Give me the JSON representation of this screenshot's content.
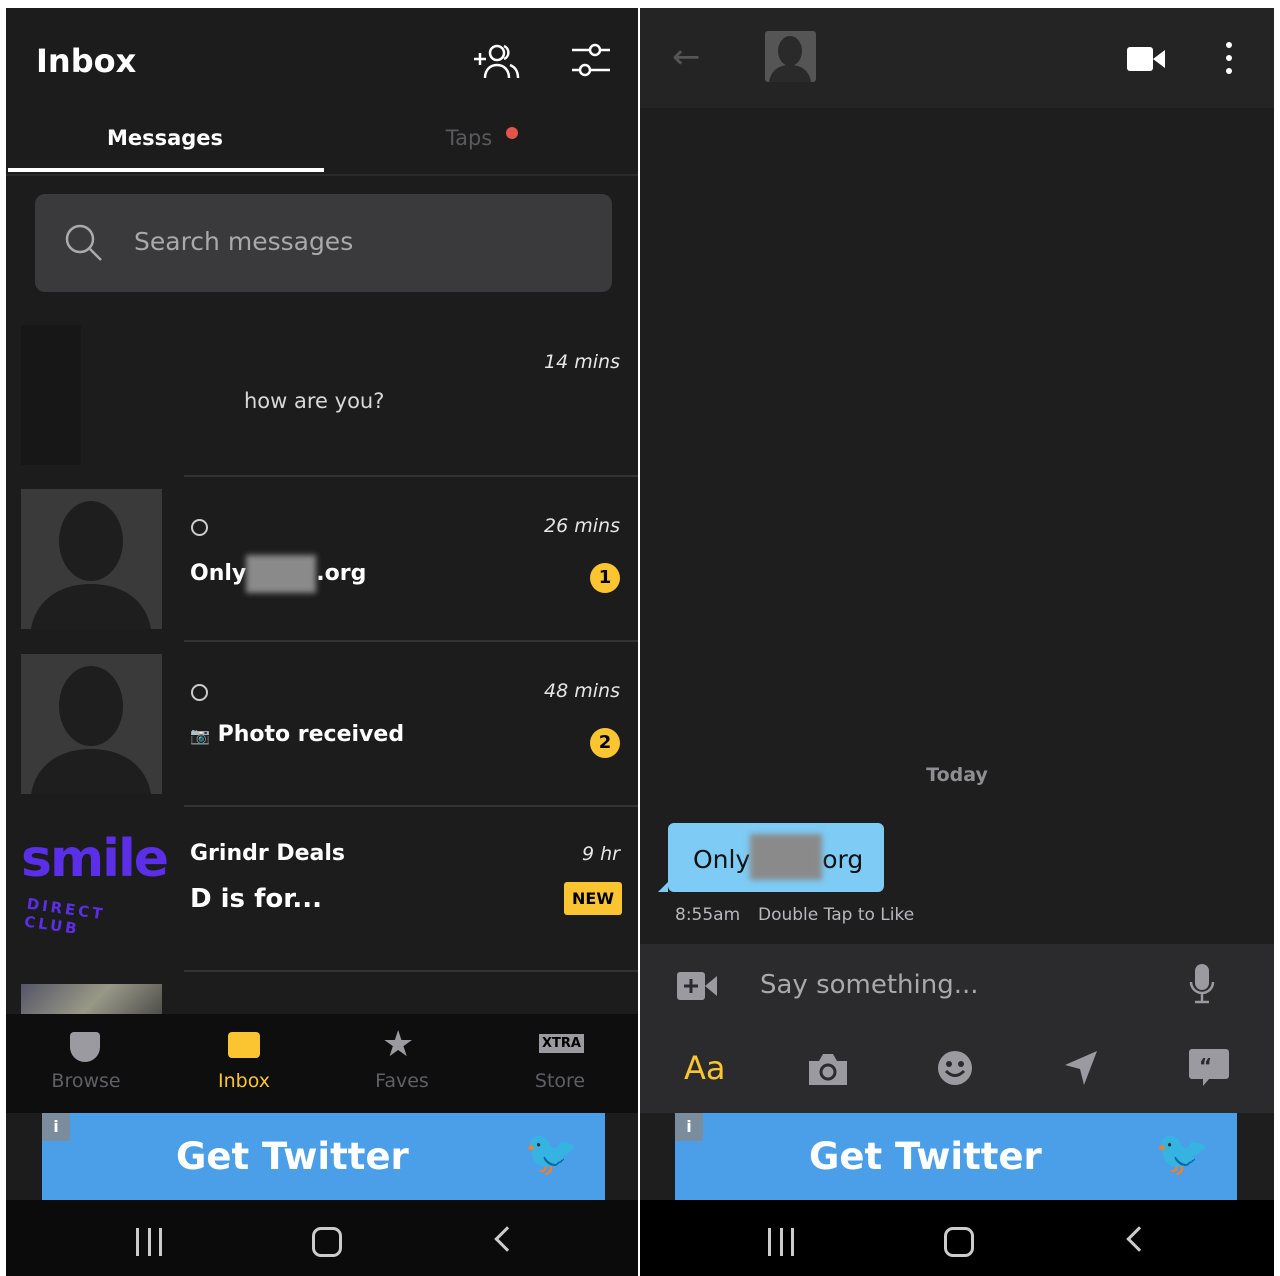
{
  "inbox": {
    "title": "Inbox",
    "tabs": [
      {
        "label": "Messages",
        "active": true
      },
      {
        "label": "Taps",
        "has_dot": true
      }
    ],
    "search_placeholder": "Search messages",
    "conversations": [
      {
        "time": "14 mins",
        "preview": "how are you?"
      },
      {
        "time": "26 mins",
        "name": "Only",
        "name_suffix": ".org",
        "unread": "1"
      },
      {
        "time": "48 mins",
        "preview": "Photo received",
        "unread": "2"
      },
      {
        "time": "9 hr",
        "name": "Grindr Deals",
        "preview": "D is for...",
        "badge": "NEW",
        "logo_text": "smile",
        "logo_sub": "DIRECT CLUB"
      }
    ],
    "bottom_tabs": [
      {
        "label": "Browse"
      },
      {
        "label": "Inbox",
        "active": true
      },
      {
        "label": "Faves"
      },
      {
        "label": "Store",
        "icon_text": "XTRA"
      }
    ]
  },
  "chat": {
    "date_label": "Today",
    "message": {
      "prefix": "Only",
      "suffix": "org",
      "time": "8:55am",
      "hint": "Double Tap to Like"
    },
    "input_placeholder": "Say something...",
    "format_label": "Aa"
  },
  "ad": {
    "label": "Get Twitter",
    "info": "i"
  },
  "colors": {
    "accent": "#fbc531",
    "bubble": "#7ecbf5",
    "ad": "#4b9fe9",
    "notification_dot": "#e5534b",
    "logo": "#5b2ee8"
  }
}
